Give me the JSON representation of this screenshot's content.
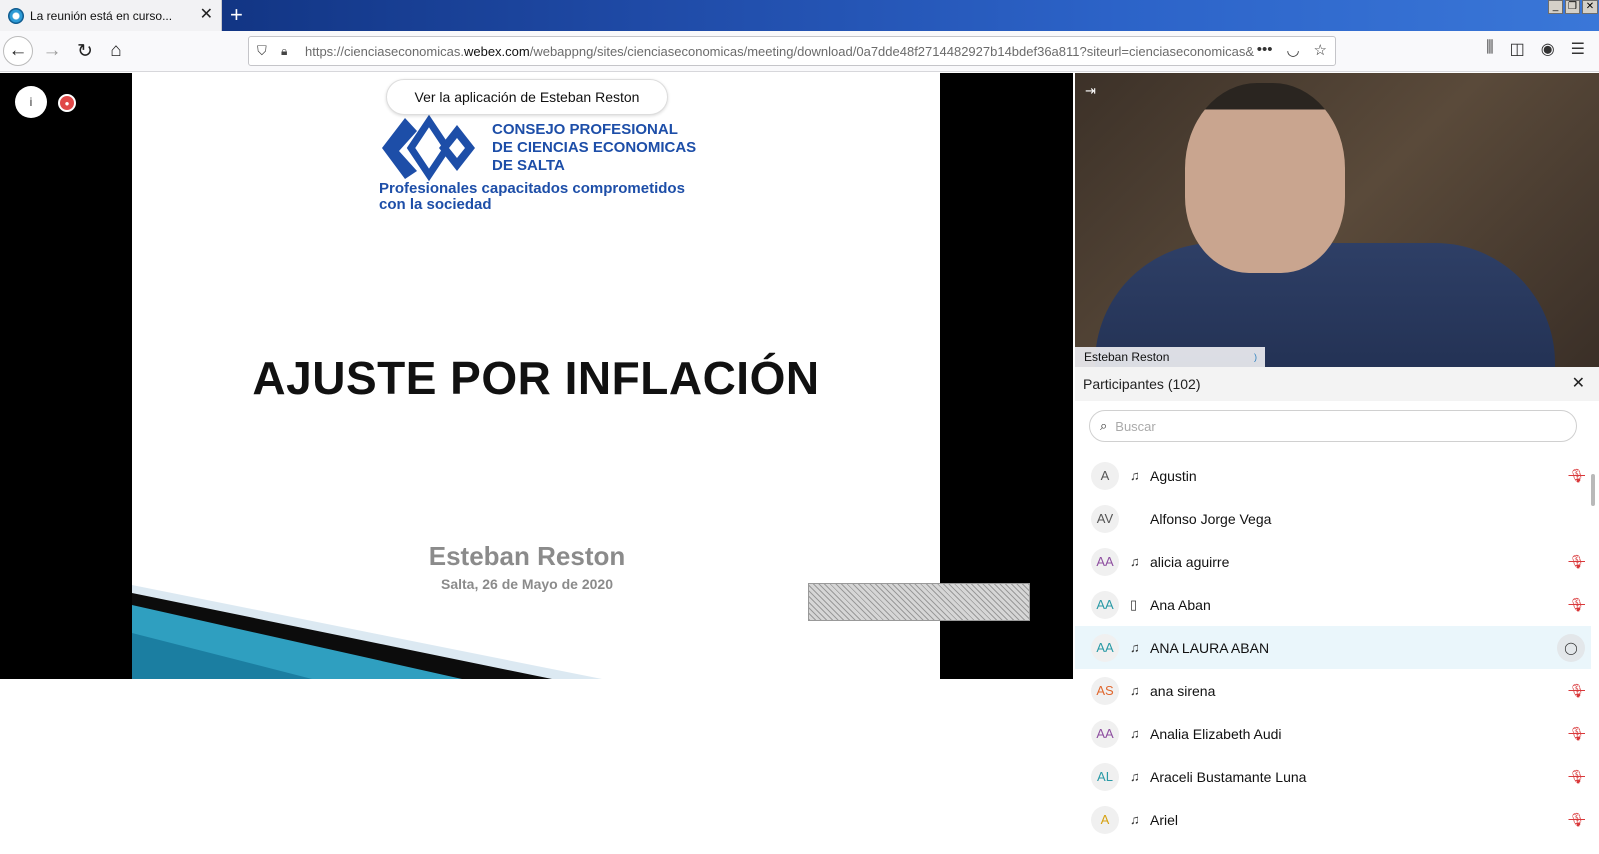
{
  "browser": {
    "tab_title": "La reunión está en curso...",
    "url_prefix": "https://cienciaseconomicas.",
    "url_domain": "webex.com",
    "url_suffix": "/webappng/sites/cienciaseconomicas/meeting/download/0a7dde48f2714482927b14bdef36a811?siteurl=cienciaseconomicas&",
    "new_tab": "+",
    "url_more": "•••"
  },
  "meeting": {
    "view_app_label": "Ver la aplicación de Esteban Reston",
    "info_icon": "i"
  },
  "slide": {
    "org_line1": "CONSEJO PROFESIONAL",
    "org_line2": "DE CIENCIAS ECONOMICAS",
    "org_line3": "DE SALTA",
    "tagline_line1": "Profesionales capacitados comprometidos",
    "tagline_line2": "con la sociedad",
    "title": "AJUSTE POR INFLACIÓN",
    "presenter": "Esteban Reston",
    "date": "Salta, 26 de Mayo de 2020"
  },
  "video": {
    "name": "Esteban Reston"
  },
  "participants": {
    "header": "Participantes (102)",
    "search_placeholder": "Buscar",
    "list": [
      {
        "initials": "A",
        "name": "Agustin",
        "audio": "headset",
        "muted": true,
        "color": "#555555"
      },
      {
        "initials": "AV",
        "name": "Alfonso Jorge Vega",
        "audio": "none",
        "muted": false,
        "color": "#555555"
      },
      {
        "initials": "AA",
        "name": "alicia aguirre",
        "audio": "headset",
        "muted": true,
        "color": "#8e4fa0"
      },
      {
        "initials": "AA",
        "name": "Ana Aban",
        "audio": "phone",
        "muted": true,
        "color": "#2a9aa6"
      },
      {
        "initials": "AA",
        "name": "ANA LAURA ABAN",
        "audio": "headset",
        "muted": false,
        "chat": true,
        "color": "#2a9aa6"
      },
      {
        "initials": "AS",
        "name": "ana sirena",
        "audio": "headset",
        "muted": true,
        "color": "#e0672e"
      },
      {
        "initials": "AA",
        "name": "Analia Elizabeth Audi",
        "audio": "headset",
        "muted": true,
        "color": "#8e4fa0"
      },
      {
        "initials": "AL",
        "name": "Araceli Bustamante Luna",
        "audio": "headset",
        "muted": true,
        "color": "#2a9aa6"
      },
      {
        "initials": "A",
        "name": "Ariel",
        "audio": "headset",
        "muted": true,
        "color": "#d6a10f"
      }
    ]
  }
}
